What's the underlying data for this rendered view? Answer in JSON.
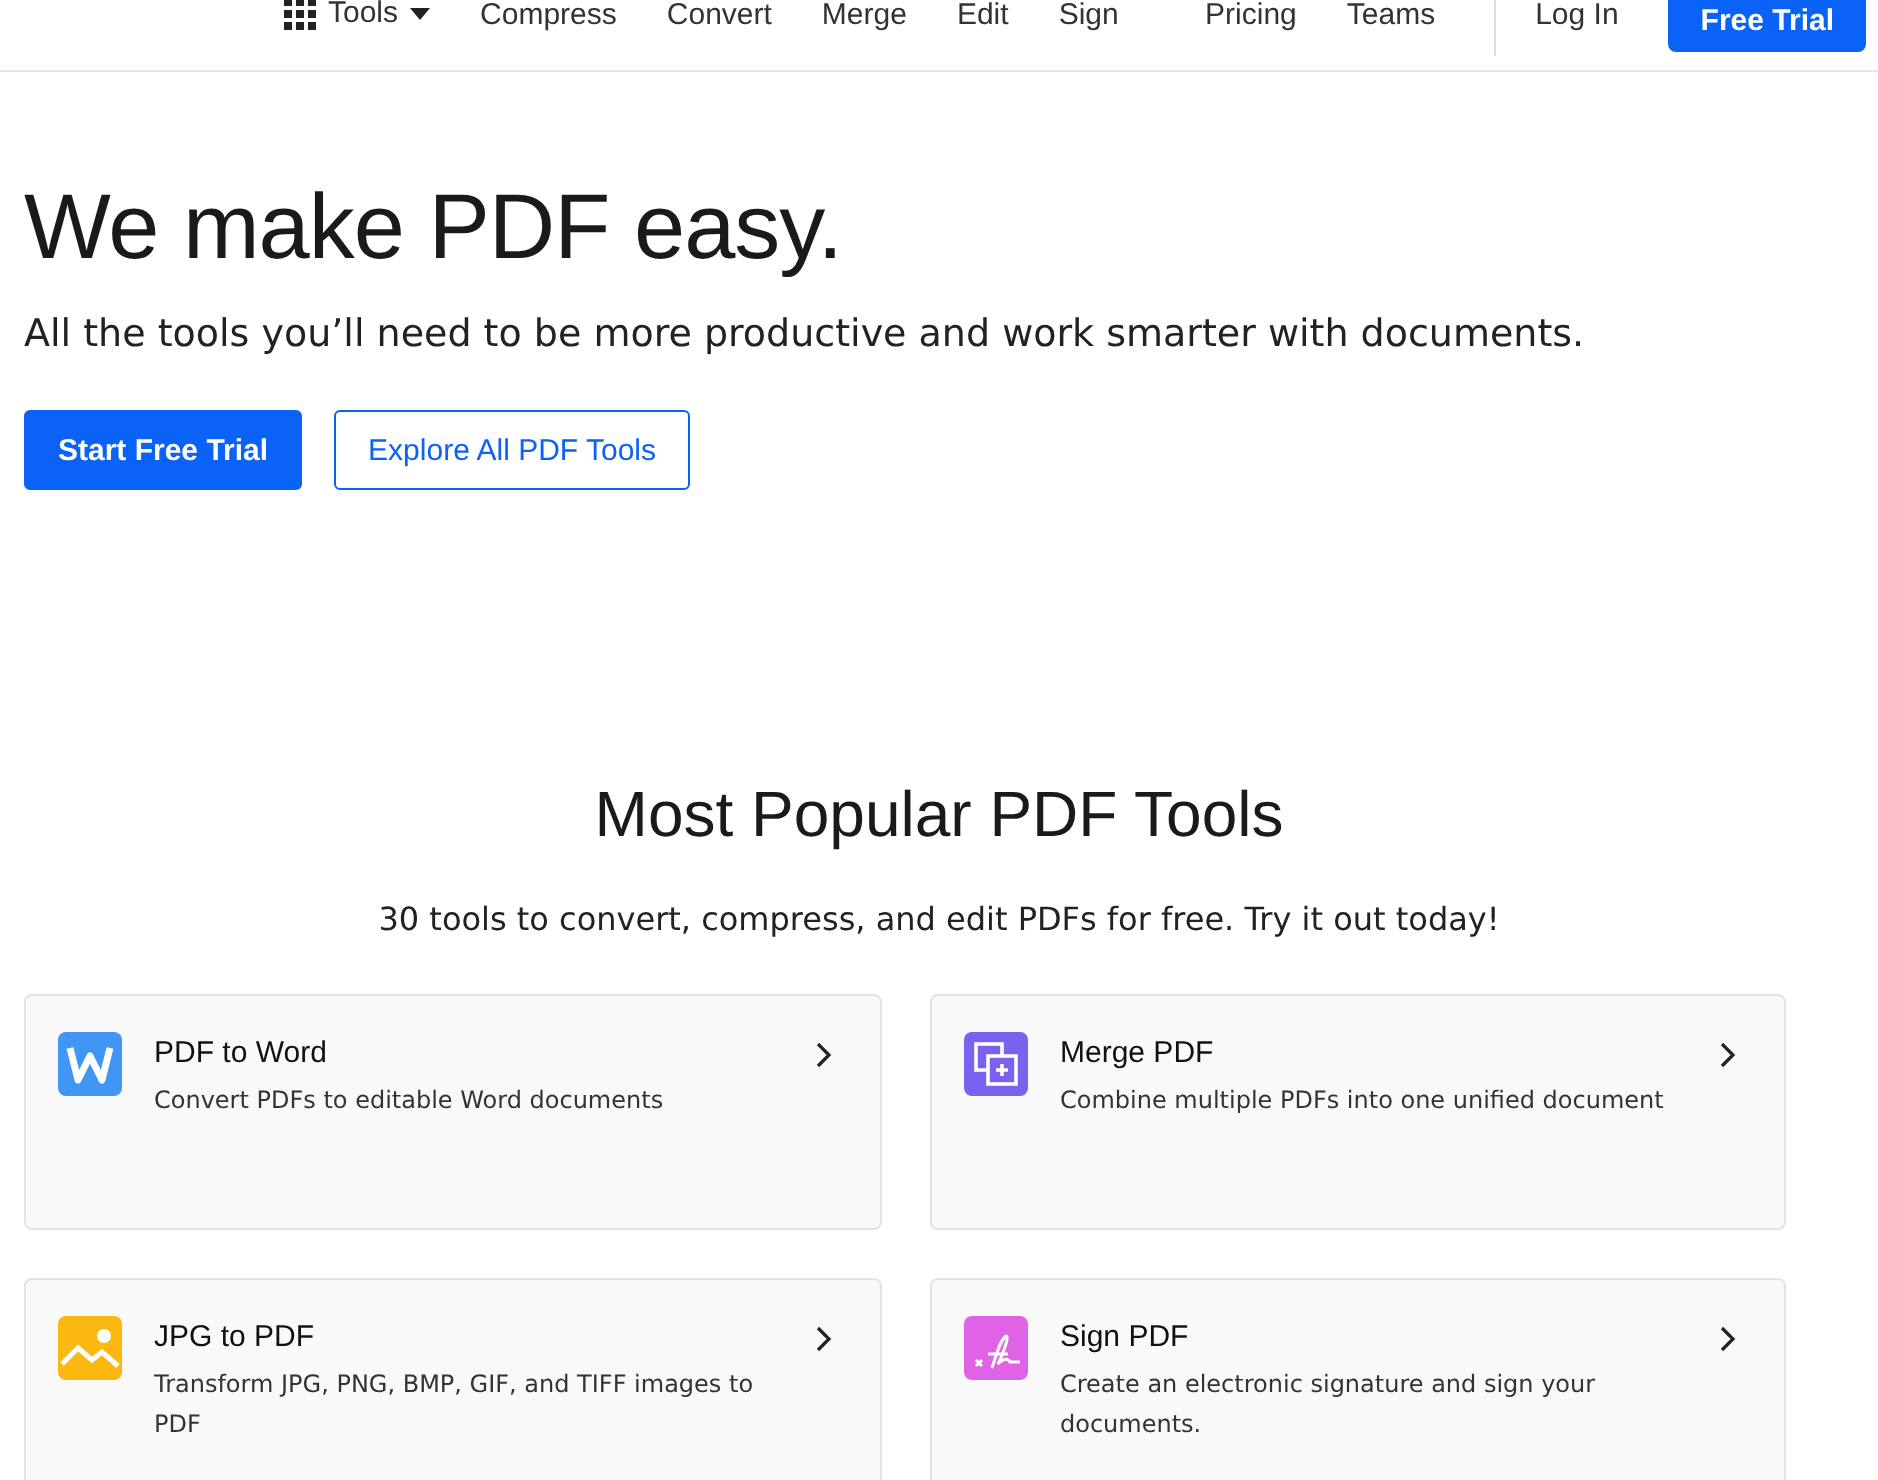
{
  "nav": {
    "tools": "Tools",
    "links": [
      "Compress",
      "Convert",
      "Merge",
      "Edit",
      "Sign"
    ],
    "secondary": [
      "Pricing",
      "Teams"
    ],
    "login": "Log In",
    "cta": "Free Trial"
  },
  "hero": {
    "title": "We make PDF easy.",
    "subtitle": "All the tools you’ll need to be more productive and work smarter with documents.",
    "primary": "Start Free Trial",
    "secondary": "Explore All PDF Tools"
  },
  "popular": {
    "title": "Most Popular PDF Tools",
    "subtitle": "30 tools to convert, compress, and edit PDFs for free. Try it out today!",
    "cards": [
      {
        "kind": "word",
        "color": "#4196f5",
        "title": "PDF to Word",
        "description": "Convert PDFs to editable Word documents"
      },
      {
        "kind": "merge",
        "color": "#7b61f0",
        "title": "Merge PDF",
        "description": "Combine multiple PDFs into one unified document"
      },
      {
        "kind": "image",
        "color": "#fbb810",
        "title": "JPG to PDF",
        "description": "Transform JPG, PNG, BMP, GIF, and TIFF images to PDF"
      },
      {
        "kind": "sign",
        "color": "#e163e5",
        "title": "Sign PDF",
        "description": "Create an electronic signature and sign your documents."
      }
    ]
  }
}
